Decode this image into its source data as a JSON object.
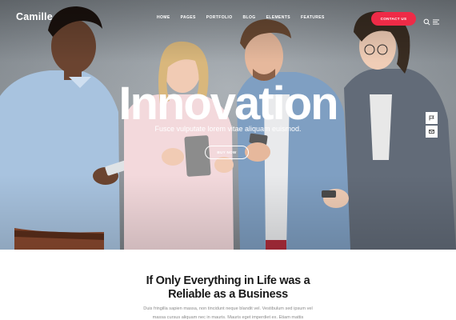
{
  "brand": {
    "logo": "Camille"
  },
  "nav": {
    "items": [
      "HOME",
      "PAGES",
      "PORTFOLIO",
      "BLOG",
      "ELEMENTS",
      "FEATURES"
    ],
    "cta_label": "CONTACT US",
    "icons": [
      "search-icon",
      "menu-icon"
    ]
  },
  "hero": {
    "title": "Innovation",
    "subtitle": "Fusce vulputate lorem vitae aliquam euismod.",
    "button_label": "BUY NOW"
  },
  "side_buttons": [
    "flag-icon",
    "mail-icon"
  ],
  "content": {
    "heading_line1": "If Only Everything in Life was a",
    "heading_line2": "Reliable as a Business",
    "body_line1": "Duis fringilla sapien massa, non tincidunt neque blandit vel. Vestibulum sed ipsum vel",
    "body_line2": "massa cursus aliquam nec in mauris. Mauris eget imperdiet ex. Etiam mattis"
  },
  "colors": {
    "accent": "#ee2b47",
    "heading": "#1a1a1a",
    "body": "#8a8a8a"
  }
}
